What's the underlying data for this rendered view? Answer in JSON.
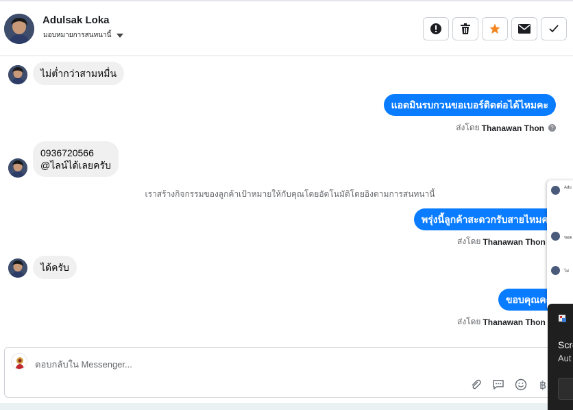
{
  "header": {
    "name": "Adulsak Loka",
    "assign_label": "มอบหมายการสนทนานี้"
  },
  "messages": {
    "m1": "ไม่ต่ำกว่าสามหมื่น",
    "m2": "แอดมินรบกวนขอเบอร์ติดต่อได้ไหมคะ",
    "m3_line1": "0936720566",
    "m3_line2": "@ไลน์ได้เลยครับ",
    "system_note": "เราสร้างกิจกรรมของลูกค้าเป้าหมายให้กับคุณโดยอัตโนมัติโดยอิงตามการสนทนานี้",
    "m4": "พรุ่งนี้ลูกค้าสะดวกรับสายไหมคะ",
    "m5": "ได้ครับ",
    "m6": "ขอบคุณคะ"
  },
  "sent_by": {
    "prefix": "ส่งโดย",
    "agent": "Thanawan Thon"
  },
  "composer": {
    "placeholder": "ตอบกลับใน Messenger..."
  },
  "side_panel": {
    "item1": "Adu",
    "item2": "ขอด",
    "item3": "ไม่"
  },
  "toast": {
    "title": "Scre",
    "subtitle": "Aut"
  },
  "colors": {
    "outgoing_bubble": "#0a7cff",
    "incoming_bubble": "#f0f0f0",
    "star": "#f5851f"
  }
}
